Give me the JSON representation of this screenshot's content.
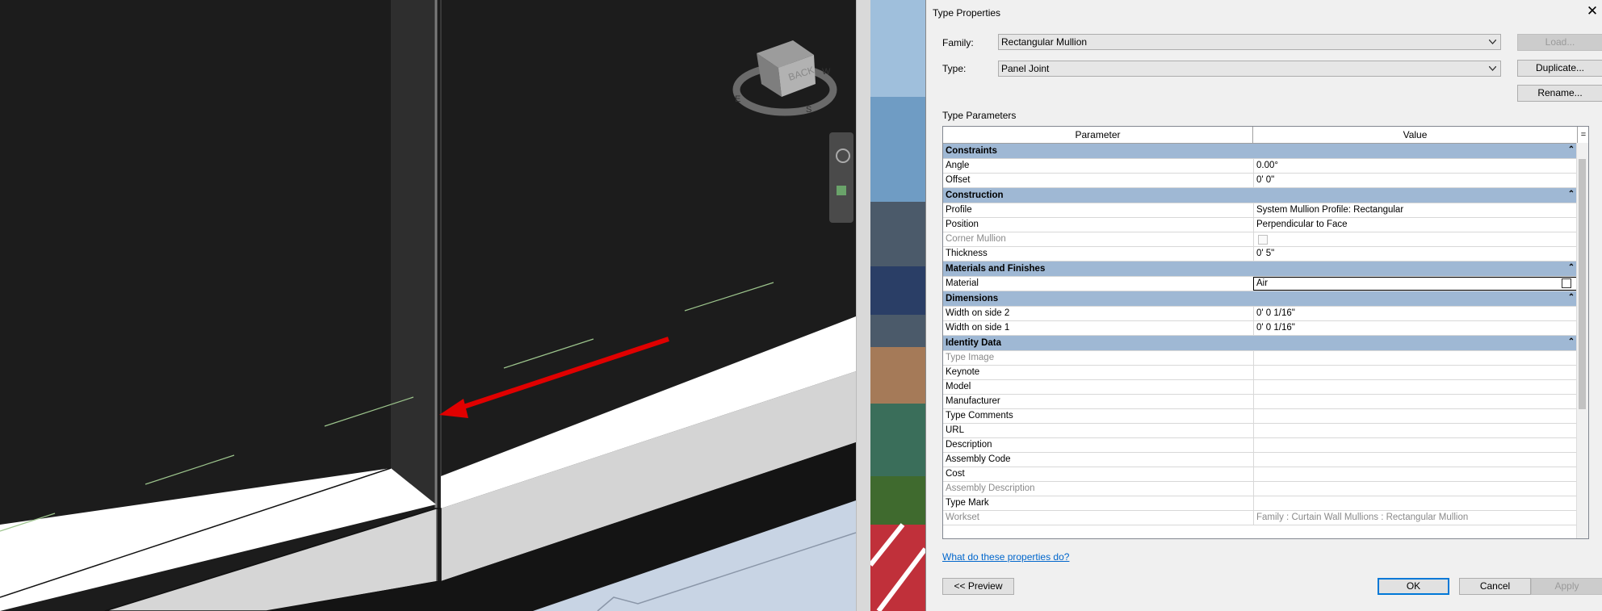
{
  "viewport": {
    "viewcube_face": "BACK",
    "compass": {
      "e": "E",
      "s": "S",
      "w": "W"
    }
  },
  "dialog": {
    "title": "Type Properties",
    "close_glyph": "✕",
    "family_label": "Family:",
    "family_value": "Rectangular Mullion",
    "type_label": "Type:",
    "type_value": "Panel Joint",
    "load_button": "Load...",
    "duplicate_button": "Duplicate...",
    "rename_button": "Rename...",
    "type_parameters_label": "Type Parameters",
    "col_parameter": "Parameter",
    "col_value": "Value",
    "col_menu": "=",
    "help_link": "What do these properties do?",
    "preview_button": "<< Preview",
    "ok_button": "OK",
    "cancel_button": "Cancel",
    "apply_button": "Apply",
    "groups": [
      {
        "name": "Constraints",
        "rows": [
          {
            "param": "Angle",
            "value": "0.00°"
          },
          {
            "param": "Offset",
            "value": "0'  0\""
          }
        ]
      },
      {
        "name": "Construction",
        "rows": [
          {
            "param": "Profile",
            "value": "System Mullion Profile: Rectangular"
          },
          {
            "param": "Position",
            "value": "Perpendicular to Face"
          },
          {
            "param": "Corner Mullion",
            "value": "",
            "grey": true,
            "checkbox": true
          },
          {
            "param": "Thickness",
            "value": "0'  5\""
          }
        ]
      },
      {
        "name": "Materials and Finishes",
        "rows": [
          {
            "param": "Material",
            "value": "Air",
            "selected": true
          }
        ]
      },
      {
        "name": "Dimensions",
        "rows": [
          {
            "param": "Width on side 2",
            "value": "0'  0 1/16\""
          },
          {
            "param": "Width on side 1",
            "value": "0'  0 1/16\""
          }
        ]
      },
      {
        "name": "Identity Data",
        "rows": [
          {
            "param": "Type Image",
            "value": "",
            "grey": true
          },
          {
            "param": "Keynote",
            "value": "",
            "edit": true
          },
          {
            "param": "Model",
            "value": "",
            "edit": true
          },
          {
            "param": "Manufacturer",
            "value": "",
            "edit": true
          },
          {
            "param": "Type Comments",
            "value": "",
            "edit": true
          },
          {
            "param": "URL",
            "value": "",
            "edit": true
          },
          {
            "param": "Description",
            "value": "",
            "edit": true
          },
          {
            "param": "Assembly Code",
            "value": "",
            "edit": true
          },
          {
            "param": "Cost",
            "value": "",
            "edit": true
          },
          {
            "param": "Assembly Description",
            "value": "",
            "grey": true
          },
          {
            "param": "Type Mark",
            "value": ""
          },
          {
            "param": "Workset",
            "value": "Family  : Curtain Wall Mullions : Rectangular Mullion",
            "grey": true
          }
        ]
      }
    ]
  }
}
